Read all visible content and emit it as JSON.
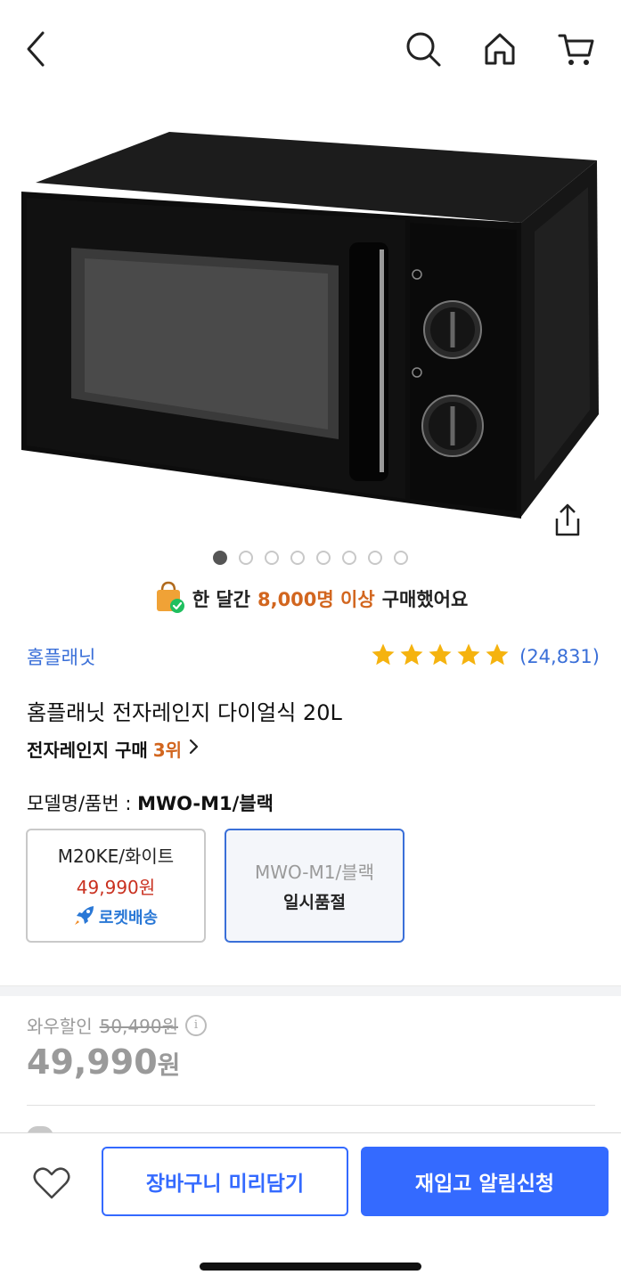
{
  "header": {
    "icons": [
      "back-icon",
      "search-icon",
      "home-icon",
      "cart-icon"
    ]
  },
  "gallery": {
    "image_subject": "black-microwave",
    "dot_count": 8,
    "active_dot": 0
  },
  "social_proof": {
    "prefix": "한 달간",
    "highlight": "8,000명 이상",
    "suffix": "구매했어요"
  },
  "product": {
    "brand": "홈플래닛",
    "rating_stars": 5,
    "review_count": "(24,831)",
    "title": "홈플래닛 전자레인지 다이얼식 20L",
    "rank_prefix": "전자레인지 구매",
    "rank_value": "3위"
  },
  "options": {
    "label_prefix": "모델명/품번 :",
    "selected_value": "MWO-M1/블랙",
    "items": [
      {
        "name": "M20KE/화이트",
        "price": "49,990원",
        "badge": "로켓배송"
      },
      {
        "name": "MWO-M1/블랙",
        "status": "일시품절"
      }
    ]
  },
  "pricing": {
    "wow_label": "와우할인",
    "original_price": "50,490원",
    "final_price": "49,990",
    "currency": "원"
  },
  "bottom_bar": {
    "cart_button": "장바구니 미리담기",
    "notify_button": "재입고 알림신청"
  },
  "colors": {
    "accent_blue": "#346aff",
    "link_blue": "#3a6fd8",
    "highlight_orange": "#d2661f",
    "price_red": "#c9301f",
    "star_yellow": "#f5b30f"
  }
}
